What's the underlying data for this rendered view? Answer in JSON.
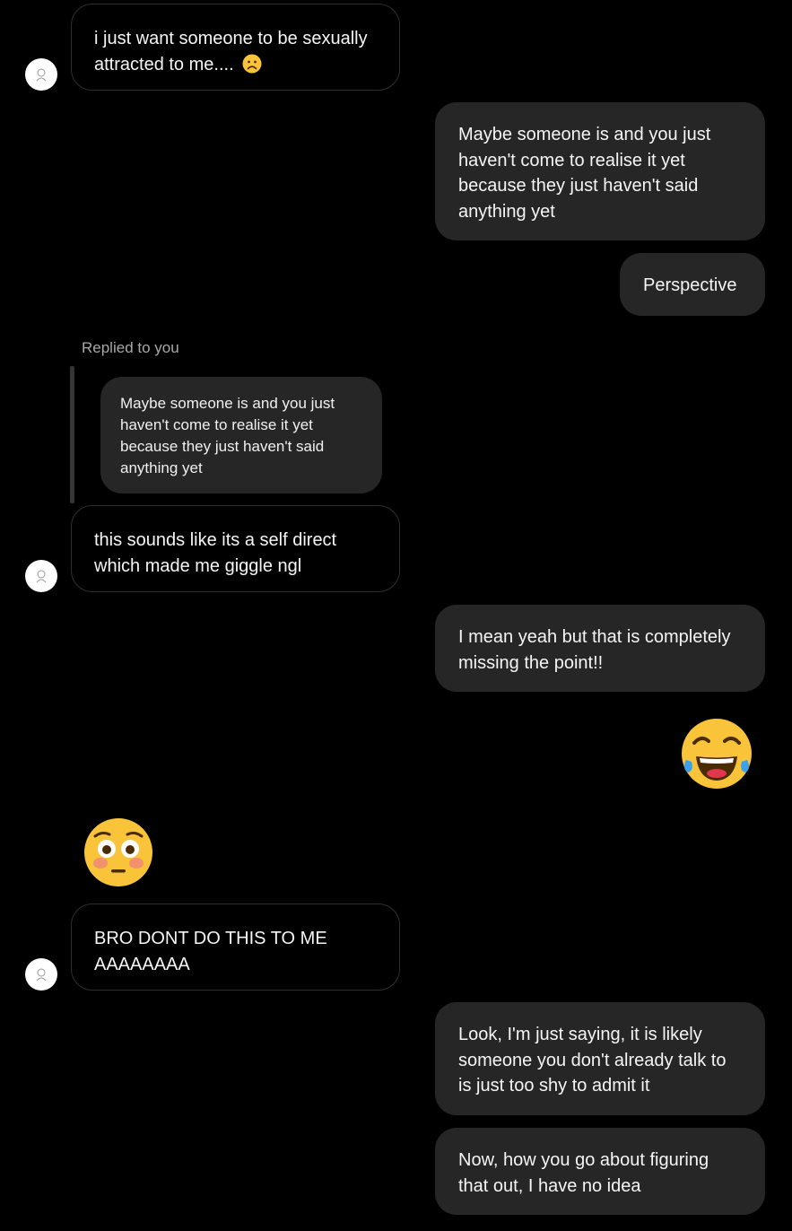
{
  "messages": [
    {
      "id": "m1",
      "direction": "incoming",
      "text": "i just want someone to be sexually attracted to me....",
      "emoji_icon": "frowning-face-icon"
    },
    {
      "id": "m2",
      "direction": "outgoing",
      "text": "Maybe someone is and you just haven't come to realise it yet because they just haven't said anything yet"
    },
    {
      "id": "m3",
      "direction": "outgoing",
      "text": "Perspective"
    },
    {
      "id": "m4",
      "direction": "incoming",
      "reply": {
        "label": "Replied to you",
        "quoted_text": "Maybe someone is and you just haven't come to realise it yet because they just haven't said anything yet"
      },
      "text": "this sounds like its a self direct which made me giggle ngl"
    },
    {
      "id": "m5",
      "direction": "outgoing",
      "text": "I mean yeah but that is completely missing the point!!"
    },
    {
      "id": "m6",
      "direction": "outgoing",
      "emoji_icon": "face-with-tears-of-joy-icon"
    },
    {
      "id": "m7",
      "direction": "incoming",
      "emoji_icon": "flushed-face-icon"
    },
    {
      "id": "m8",
      "direction": "incoming",
      "text": "BRO DONT DO THIS TO ME AAAAAAAA"
    },
    {
      "id": "m9",
      "direction": "outgoing",
      "text": "Look, I'm just saying, it is likely someone you don't already talk to is just too shy to admit it"
    },
    {
      "id": "m10",
      "direction": "outgoing",
      "text": "Now, how you go about figuring that out, I have no idea"
    }
  ],
  "colors": {
    "background": "#000000",
    "outgoing_bubble": "#262626",
    "incoming_border": "#2f2f2f",
    "text": "#f5f5f5",
    "muted_text": "#a8a8a8",
    "emoji_yellow": "#f9c33a"
  }
}
